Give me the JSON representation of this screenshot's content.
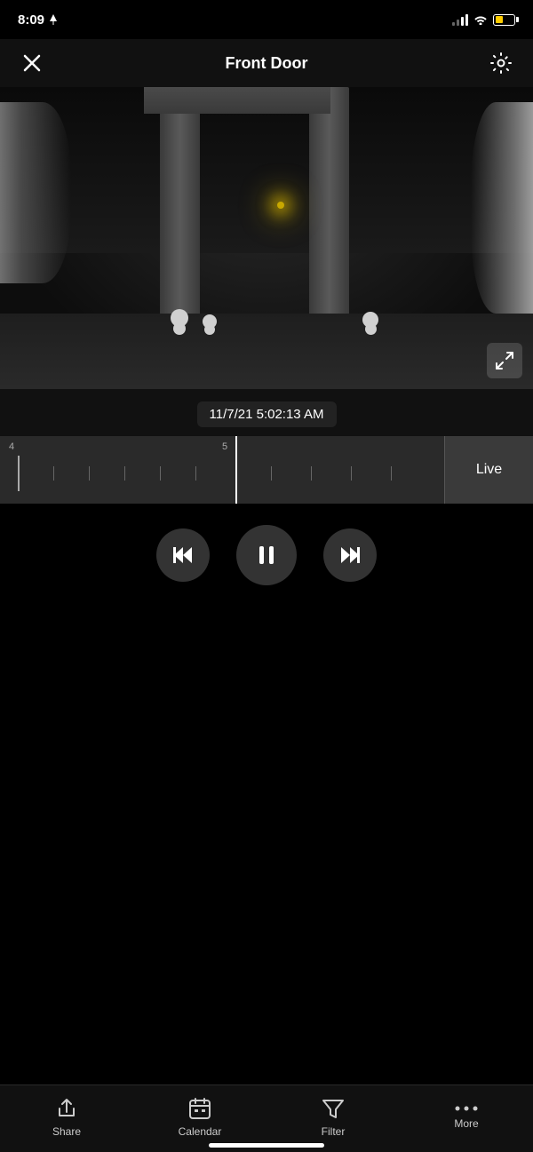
{
  "statusBar": {
    "time": "8:09",
    "batteryLevel": 40
  },
  "topNav": {
    "title": "Front Door",
    "closeLabel": "close",
    "settingsLabel": "settings"
  },
  "video": {
    "expandLabel": "expand"
  },
  "timestamp": {
    "value": "11/7/21 5:02:13 AM"
  },
  "timeline": {
    "label4": "4",
    "label5": "5",
    "liveLabel": "Live"
  },
  "playback": {
    "skipBackLabel": "skip back",
    "pauseLabel": "pause",
    "skipForwardLabel": "skip forward"
  },
  "bottomNav": {
    "share": "Share",
    "calendar": "Calendar",
    "filter": "Filter",
    "more": "More"
  }
}
